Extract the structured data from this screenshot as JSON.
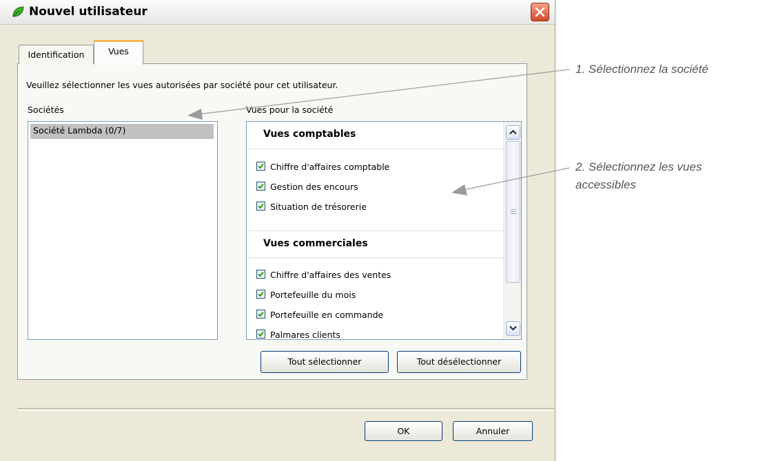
{
  "window": {
    "title": "Nouvel utilisateur"
  },
  "tabs": [
    {
      "label": "Identification",
      "active": false
    },
    {
      "label": "Vues",
      "active": true
    }
  ],
  "instruction": "Veuillez sélectionner les vues autorisées par société pour cet utilisateur.",
  "societes": {
    "label": "Sociétés",
    "items": [
      {
        "label": "Société Lambda (0/7)",
        "selected": true
      }
    ]
  },
  "vues": {
    "label": "Vues pour la société",
    "groups": [
      {
        "title": "Vues comptables",
        "items": [
          {
            "label": "Chiffre d'affaires comptable",
            "checked": true
          },
          {
            "label": "Gestion des encours",
            "checked": true
          },
          {
            "label": "Situation de trésorerie",
            "checked": true
          }
        ]
      },
      {
        "title": "Vues commerciales",
        "items": [
          {
            "label": "Chiffre d'affaires des ventes",
            "checked": true
          },
          {
            "label": "Portefeuille du mois",
            "checked": true
          },
          {
            "label": "Portefeuille en commande",
            "checked": true
          },
          {
            "label": "Palmares clients",
            "checked": true
          }
        ]
      }
    ]
  },
  "buttons": {
    "select_all": "Tout sélectionner",
    "deselect_all": "Tout désélectionner",
    "ok": "OK",
    "cancel": "Annuler"
  },
  "annotations": {
    "step1": "1. Sélectionnez la société",
    "step2": "2. Sélectionnez les vues accessibles"
  },
  "colors": {
    "window_bg": "#ece9d8",
    "check": "#21a121",
    "active_tab_accent": "#f7b64b",
    "close_button": "#d54a2a"
  }
}
